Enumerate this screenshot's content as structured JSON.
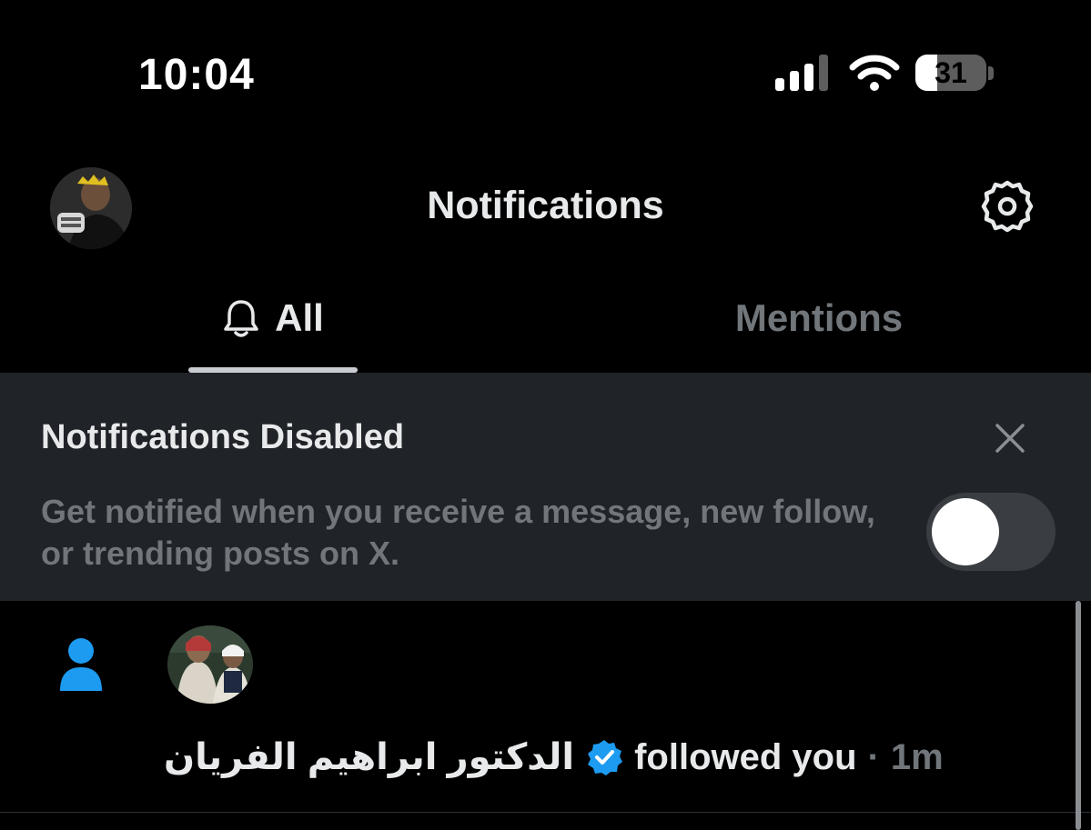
{
  "status_bar": {
    "time": "10:04",
    "battery": "31",
    "battery_level": 0.31
  },
  "header": {
    "title": "Notifications"
  },
  "tabs": [
    {
      "label": "All",
      "active": true
    },
    {
      "label": "Mentions",
      "active": false
    }
  ],
  "banner": {
    "title": "Notifications Disabled",
    "description": "Get notified when you receive a message, new follow, or trending posts on X.",
    "toggle_on": false
  },
  "notifications": [
    {
      "type": "follow",
      "user_name": "الدكتور ابراهيم الفريان",
      "verified": true,
      "action": "followed you",
      "separator": "·",
      "time_ago": "1m"
    }
  ],
  "colors": {
    "background": "#000000",
    "banner_bg": "#202327",
    "accent_blue": "#1d9bf0",
    "muted_text": "#71767b",
    "primary_text": "#e7e9ea"
  },
  "icons": {
    "settings": "gear-icon",
    "tab_all": "bell-icon",
    "close": "close-icon",
    "follow": "person-icon",
    "verified": "verified-badge-icon"
  }
}
